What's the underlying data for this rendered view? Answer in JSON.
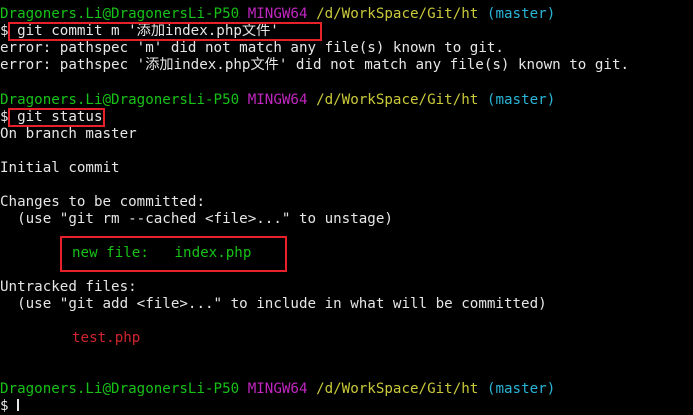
{
  "colors": {
    "background": "#000000",
    "text": "#e6e6e6",
    "user": "#17c217",
    "system": "#c026c0",
    "path": "#c9c93a",
    "branch": "#29b4d6",
    "staged": "#17c217",
    "untracked": "#d0252f",
    "highlight": "#e8202a"
  },
  "prompt": {
    "user_host": "Dragoners.Li@DragonersLi-P50",
    "system": "MINGW64",
    "path": "/d/WorkSpace/Git/ht",
    "branch": "(master)",
    "symbol": "$"
  },
  "session": {
    "cmd1": "git commit m '添加index.php文件'",
    "error1": "error: pathspec 'm' did not match any file(s) known to git.",
    "error2": "error: pathspec '添加index.php文件' did not match any file(s) known to git.",
    "cmd2": "git status",
    "on_branch": "On branch master",
    "initial_commit": "Initial commit",
    "changes_header": "Changes to be committed:",
    "unstage_hint": "  (use \"git rm --cached <file>...\" to unstage)",
    "staged_label": "new file:",
    "staged_file": "index.php",
    "untracked_header": "Untracked files:",
    "untracked_hint": "  (use \"git add <file>...\" to include in what will be committed)",
    "untracked_file": "test.php"
  }
}
